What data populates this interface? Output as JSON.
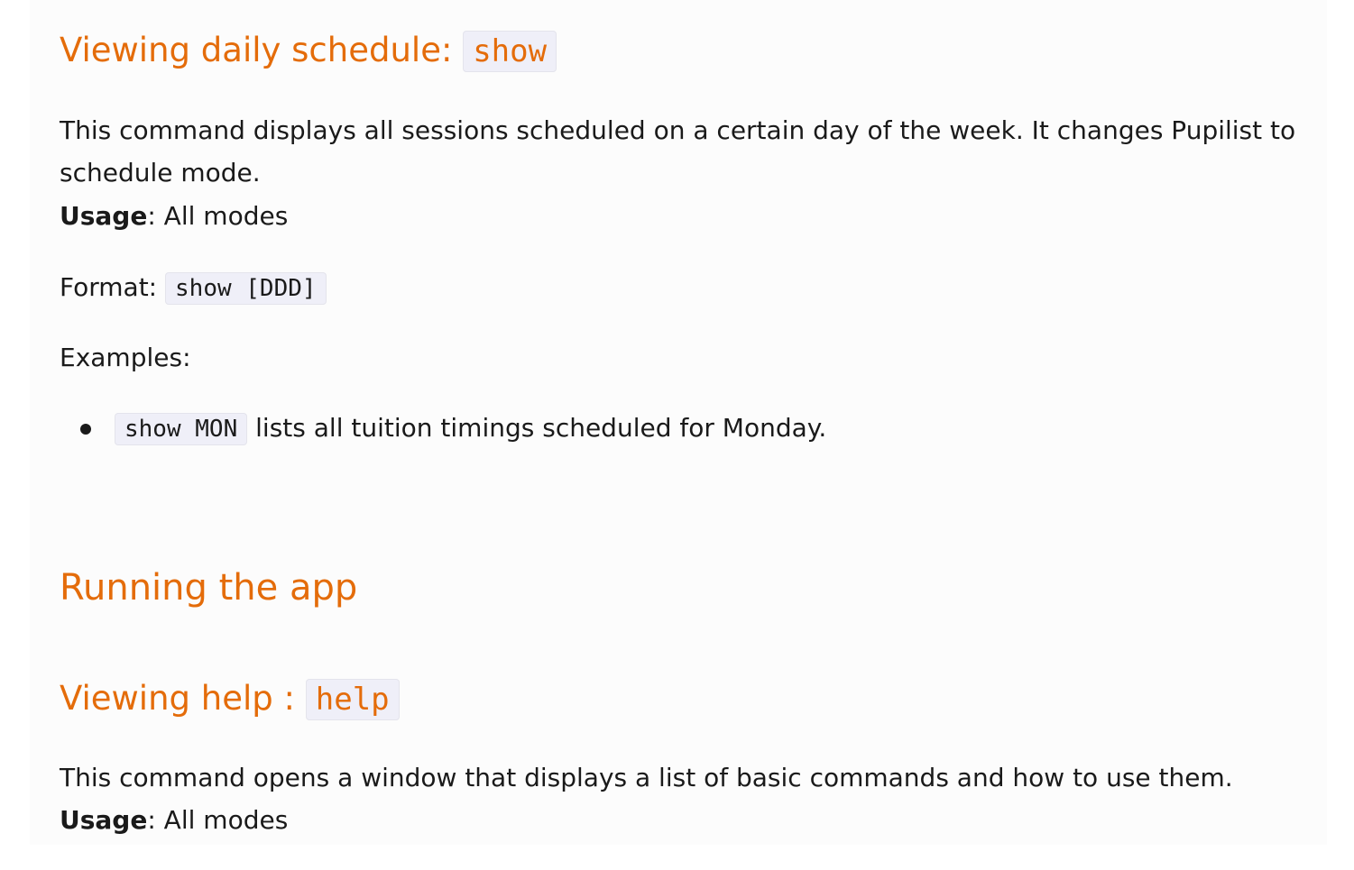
{
  "sections": [
    {
      "title": "Viewing daily schedule:",
      "command": "show",
      "description": "This command displays all sessions scheduled on a certain day of the week. It changes Pupilist to schedule mode.",
      "usage_label": "Usage",
      "usage_value": ": All modes",
      "format_label": "Format:",
      "format_code": "show [DDD]",
      "examples_label": "Examples:",
      "examples": [
        {
          "code": "show MON",
          "text": "lists all tuition timings scheduled for Monday."
        }
      ]
    },
    {
      "title": "Running the app"
    },
    {
      "title": "Viewing help :",
      "command": "help",
      "description": "This command opens a window that displays a list of basic commands and how to use them.",
      "usage_label": "Usage",
      "usage_value": ": All modes"
    }
  ]
}
